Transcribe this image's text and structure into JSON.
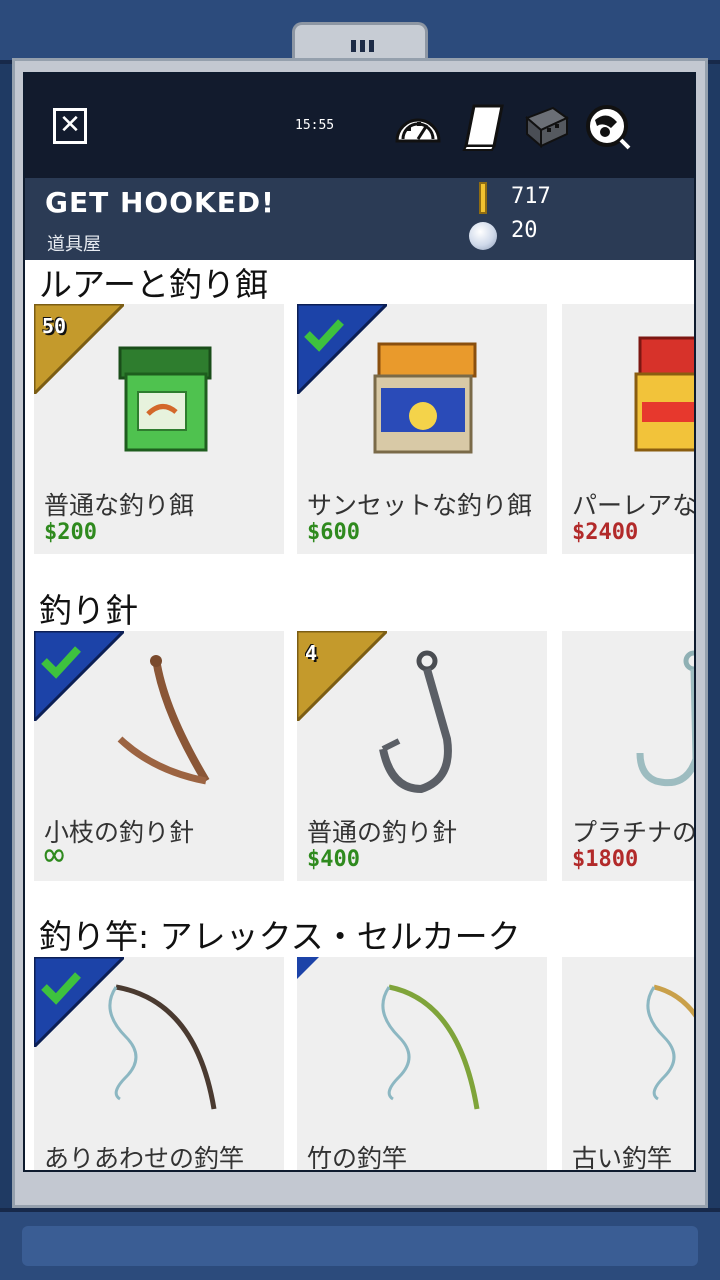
{
  "status_bar": {
    "clock": "15:55"
  },
  "header": {
    "title": "GET HOOKED!",
    "subtitle": "道具屋",
    "coins": "717",
    "pearls": "20"
  },
  "toolbar_icons": [
    "speedometer-icon",
    "journal-icon",
    "tackle-box-icon",
    "no-fishing-icon"
  ],
  "colors": {
    "topbar": "#121b2d",
    "header": "#2b3b55",
    "owned_badge": "#1c43a8",
    "count_badge": "#c49a2c",
    "price_affordable": "#2f8a1e",
    "price_unaffordable": "#b22a2a"
  },
  "sections": [
    {
      "title": "ルアーと釣り餌",
      "items": [
        {
          "name": "普通な釣り餌",
          "price": "$200",
          "badge": "50",
          "badge_type": "count",
          "affordable": true
        },
        {
          "name": "サンセットな釣り餌",
          "price": "$600",
          "badge": "",
          "badge_type": "owned",
          "affordable": true
        },
        {
          "name": "パーレアな釣",
          "price": "$2400",
          "badge": "",
          "badge_type": "none",
          "affordable": false
        }
      ]
    },
    {
      "title": "釣り針",
      "items": [
        {
          "name": "小枝の釣り針",
          "price": "∞",
          "badge": "",
          "badge_type": "owned",
          "affordable": true
        },
        {
          "name": "普通の釣り針",
          "price": "$400",
          "badge": "4",
          "badge_type": "count",
          "affordable": true
        },
        {
          "name": "プラチナの釣",
          "price": "$1800",
          "badge": "",
          "badge_type": "none",
          "affordable": false
        }
      ]
    },
    {
      "title": "釣り竿: アレックス・セルカーク",
      "items": [
        {
          "name": "ありあわせの釣竿",
          "price": "",
          "badge": "",
          "badge_type": "owned",
          "affordable": true
        },
        {
          "name": "竹の釣竿",
          "price": "",
          "badge": "",
          "badge_type": "small",
          "affordable": true
        },
        {
          "name": "古い釣竿",
          "price": "",
          "badge": "",
          "badge_type": "none",
          "affordable": true
        }
      ]
    }
  ]
}
